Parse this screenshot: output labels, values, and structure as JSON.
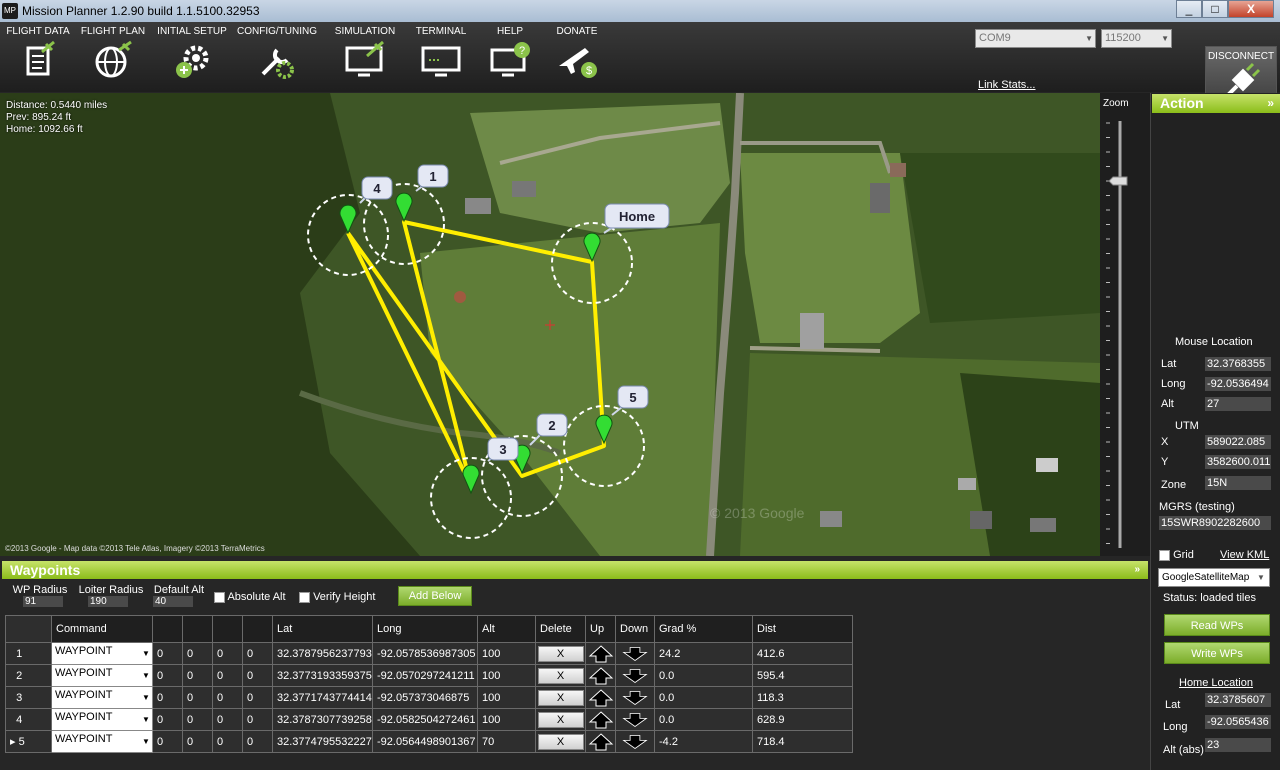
{
  "window": {
    "title": "Mission Planner 1.2.90 build 1.1.5100.32953",
    "logo": "MP",
    "min": "_",
    "max": "□",
    "close": "X"
  },
  "menu": [
    {
      "label": "FLIGHT DATA",
      "icon": "clipboard-icon"
    },
    {
      "label": "FLIGHT PLAN",
      "icon": "globe-icon"
    },
    {
      "label": "INITIAL SETUP",
      "icon": "gear-plus-icon"
    },
    {
      "label": "CONFIG/TUNING",
      "icon": "wrench-gear-icon"
    },
    {
      "label": "SIMULATION",
      "icon": "monitor-plane-icon"
    },
    {
      "label": "TERMINAL",
      "icon": "terminal-icon"
    },
    {
      "label": "HELP",
      "icon": "monitor-help-icon"
    },
    {
      "label": "DONATE",
      "icon": "plane-dollar-icon"
    }
  ],
  "connection": {
    "port": "COM9",
    "baud": "115200",
    "link_stats": "Link Stats...",
    "disconnect": "DISCONNECT"
  },
  "map": {
    "distance": "Distance: 0.5440 miles",
    "prev": "Prev: 895.24 ft",
    "home": "Home: 1092.66 ft",
    "copyright": "©2013 Google - Map data ©2013 Tele Atlas, Imagery ©2013 TerraMetrics",
    "zoom_label": "Zoom",
    "watermark": "© 2013 Google",
    "markers": [
      "4",
      "1",
      "Home",
      "2",
      "3",
      "5"
    ]
  },
  "action": {
    "title": "Action",
    "expand": "»"
  },
  "mouse_location": {
    "title": "Mouse Location",
    "lat_label": "Lat",
    "lat": "32.3768355",
    "long_label": "Long",
    "long": "-92.0536494",
    "alt_label": "Alt",
    "alt": "27",
    "utm_label": "UTM",
    "x_label": "X",
    "x": "589022.085",
    "y_label": "Y",
    "y": "3582600.011",
    "zone_label": "Zone",
    "zone": "15N",
    "mgrs_label": "MGRS (testing)",
    "mgrs": "15SWR8902282600"
  },
  "right_panel": {
    "grid_label": "Grid",
    "view_kml": "View KML",
    "map_type": "GoogleSatelliteMap",
    "status": "Status: loaded tiles",
    "read_wps": "Read WPs",
    "write_wps": "Write WPs"
  },
  "home_location": {
    "title": "Home Location",
    "lat_label": "Lat",
    "lat": "32.3785607",
    "long_label": "Long",
    "long": "-92.0565436",
    "alt_label": "Alt (abs)",
    "alt": "23"
  },
  "waypoints": {
    "title": "Waypoints",
    "collapse": "»",
    "wp_radius_label": "WP Radius",
    "wp_radius": "91",
    "loiter_label": "Loiter Radius",
    "loiter": "190",
    "default_alt_label": "Default Alt",
    "default_alt": "40",
    "absolute_alt": "Absolute Alt",
    "verify_height": "Verify Height",
    "add_below": "Add Below",
    "columns": [
      "Command",
      "",
      "",
      "",
      "",
      "Lat",
      "Long",
      "Alt",
      "Delete",
      "Up",
      "Down",
      "Grad %",
      "Dist"
    ],
    "rows": [
      {
        "num": "1",
        "command": "WAYPOINT",
        "p1": "0",
        "p2": "0",
        "p3": "0",
        "p4": "0",
        "lat": "32.3787956237793",
        "long": "-92.0578536987305",
        "alt": "100",
        "delete": "X",
        "grad": "24.2",
        "dist": "412.6"
      },
      {
        "num": "2",
        "command": "WAYPOINT",
        "p1": "0",
        "p2": "0",
        "p3": "0",
        "p4": "0",
        "lat": "32.3773193359375",
        "long": "-92.0570297241211",
        "alt": "100",
        "delete": "X",
        "grad": "0.0",
        "dist": "595.4"
      },
      {
        "num": "3",
        "command": "WAYPOINT",
        "p1": "0",
        "p2": "0",
        "p3": "0",
        "p4": "0",
        "lat": "32.3771743774414",
        "long": "-92.057373046875",
        "alt": "100",
        "delete": "X",
        "grad": "0.0",
        "dist": "118.3"
      },
      {
        "num": "4",
        "command": "WAYPOINT",
        "p1": "0",
        "p2": "0",
        "p3": "0",
        "p4": "0",
        "lat": "32.3787307739258",
        "long": "-92.0582504272461",
        "alt": "100",
        "delete": "X",
        "grad": "0.0",
        "dist": "628.9"
      },
      {
        "num": "5",
        "command": "WAYPOINT",
        "p1": "0",
        "p2": "0",
        "p3": "0",
        "p4": "0",
        "lat": "32.3774795532227",
        "long": "-92.0564498901367",
        "alt": "70",
        "delete": "X",
        "grad": "-4.2",
        "dist": "718.4"
      }
    ]
  },
  "colors": {
    "accent_green": "#8bbd1a",
    "route": "#ffee00",
    "marker": "#33dd33"
  }
}
